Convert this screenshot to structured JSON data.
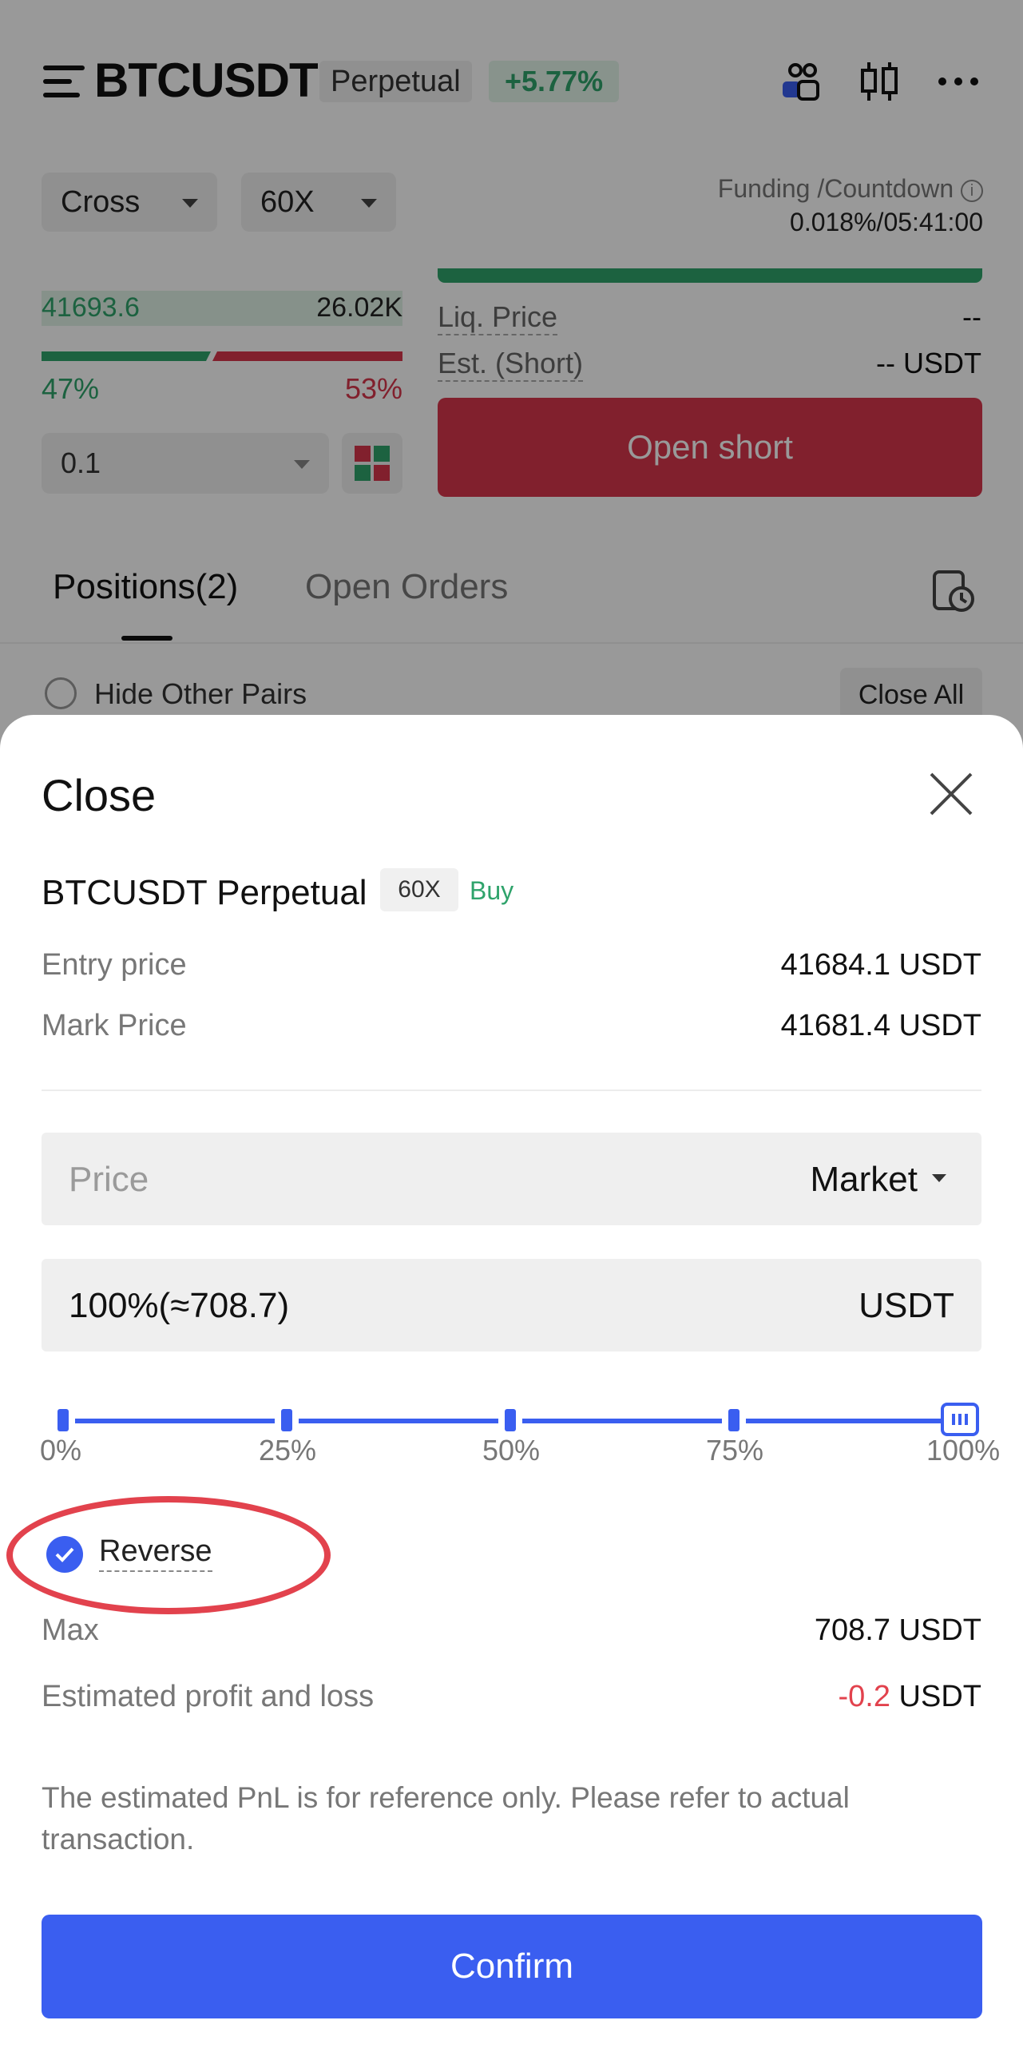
{
  "header": {
    "pair": "BTCUSDT",
    "type": "Perpetual",
    "change": "+5.77%"
  },
  "trade": {
    "margin_mode": "Cross",
    "leverage": "60X",
    "funding_label": "Funding /Countdown",
    "funding_value": "0.018%/05:41:00",
    "orderbook": [
      {
        "price": "41693.6",
        "qty": "26.02K"
      }
    ],
    "buy_pct": "47%",
    "sell_pct": "53%",
    "qty_value": "0.1",
    "liq_label": "Liq. Price",
    "liq_value": "--",
    "est_label": "Est. (Short)",
    "est_value": "-- USDT",
    "open_short": "Open short"
  },
  "tabs": [
    {
      "label": "Positions(2)"
    },
    {
      "label": "Open Orders"
    }
  ],
  "positions": {
    "hide_other_pairs": "Hide Other Pairs",
    "close_all": "Close All"
  },
  "sheet": {
    "title": "Close",
    "position_name": "BTCUSDT Perpetual",
    "leverage_tag": "60X",
    "side": "Buy",
    "entry_label": "Entry price",
    "entry_value": "41684.1 USDT",
    "mark_label": "Mark Price",
    "mark_value": "41681.4 USDT",
    "price_placeholder": "Price",
    "price_type": "Market",
    "amount_value": "100%(≈708.7)",
    "amount_unit": "USDT",
    "slider_labels": [
      "0%",
      "25%",
      "50%",
      "75%",
      "100%"
    ],
    "slider_value_percent": 100,
    "reverse_label": "Reverse",
    "reverse_checked": true,
    "max_label": "Max",
    "max_value": "708.7 USDT",
    "pnl_label": "Estimated profit and loss",
    "pnl_value": "-0.2",
    "pnl_unit": "USDT",
    "disclaimer": "The estimated PnL is for reference only. Please refer to actual transaction.",
    "confirm": "Confirm"
  },
  "colors": {
    "accent": "#3a5ef0",
    "buy": "#2fa36b",
    "sell": "#d8364b",
    "highlight": "#e2424d"
  }
}
